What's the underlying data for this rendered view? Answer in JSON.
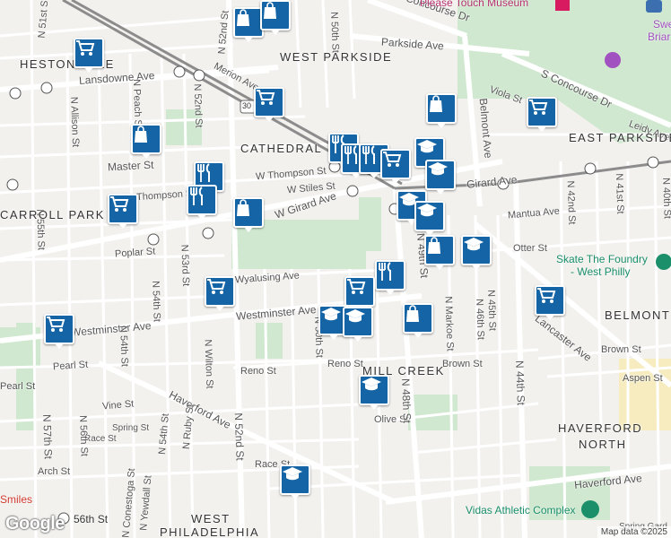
{
  "streets": [
    "Lansdowne Ave",
    "Merion Ave",
    "Master St",
    "W Thompson St",
    "Thompson St",
    "W Stiles St",
    "W Girard Ave",
    "Girard Ave",
    "Poplar St",
    "Wyalusing Ave",
    "Westminster Ave",
    "Westminster Ave",
    "Pearl St",
    "Reno St",
    "Reno St",
    "Brown St",
    "Brown St",
    "Haverford Ave",
    "Haverford Ave",
    "Vine St",
    "Spring St",
    "Race St",
    "Race St",
    "Arch St",
    "Olive St",
    "Aspen St",
    "Mantua Ave",
    "Otter St",
    "Viola St",
    "Leidy Ave",
    "Parkside Ave",
    "S Concourse Dr",
    "S Concourse Dr",
    "Belmont Ave",
    "Lancaster Ave",
    "N 52nd St",
    "N 52nd St",
    "N 53rd St",
    "N 54th St",
    "N 55th St",
    "N 56th St",
    "N 57th St",
    "N 50th St",
    "N 51st St",
    "N 49th St",
    "N 48th St",
    "N 46th St",
    "N Markoe St",
    "N 45th St",
    "N 44th St",
    "N 42nd St",
    "N 41st St",
    "N 40th St",
    "N Allison St",
    "N Peach St",
    "N Wilton St",
    "N Ruby St",
    "N Yewdall St",
    "N Conestoga St",
    "N 54th St",
    "N 50th St",
    "Spring Gard",
    "Pearl St",
    "N 52nd St",
    "N 54th St",
    "W"
  ],
  "neighborhoods": [
    "WEST PARKSIDE",
    "HESTONVILLE",
    "CATHEDRAL",
    "EAST PARKSIDE",
    "CARROLL PARK",
    "BELMONT",
    "MILL CREEK",
    "HAVERFORD",
    "NORTH",
    "WEST",
    "PHILADELPHIA"
  ],
  "pois": {
    "please_touch": "Please Touch Museum",
    "skate": "Skate The Foundry",
    "skate2": "- West Philly",
    "vidas": "Vidas Athletic Complex",
    "sweet_briar": "Swe",
    "sweet_briar2": "Briar V",
    "smiles": "Smiles",
    "station": "56th St"
  },
  "highways": [
    "30"
  ],
  "attribution": "Map data ©2025",
  "logo": "Google",
  "colors": {
    "pin": "#1565a6",
    "park": "#c8e6c9",
    "road": "#ffffff",
    "rail": "#8c8c8c",
    "water": "#a8d4f0"
  },
  "markers": [
    {
      "type": "shopping-bag"
    },
    {
      "type": "shopping-bag"
    },
    {
      "type": "shopping-cart"
    },
    {
      "type": "shopping-cart"
    },
    {
      "type": "shopping-bag"
    },
    {
      "type": "shopping-cart"
    },
    {
      "type": "restaurant"
    },
    {
      "type": "restaurant"
    },
    {
      "type": "restaurant"
    },
    {
      "type": "shopping-cart"
    },
    {
      "type": "school"
    },
    {
      "type": "school"
    },
    {
      "type": "shopping-bag"
    },
    {
      "type": "shopping-bag"
    },
    {
      "type": "restaurant"
    },
    {
      "type": "restaurant"
    },
    {
      "type": "shopping-cart"
    },
    {
      "type": "school"
    },
    {
      "type": "school"
    },
    {
      "type": "shopping-bag"
    },
    {
      "type": "school"
    },
    {
      "type": "restaurant"
    },
    {
      "type": "shopping-cart"
    },
    {
      "type": "school"
    },
    {
      "type": "school"
    },
    {
      "type": "shopping-cart"
    },
    {
      "type": "shopping-bag"
    },
    {
      "type": "school"
    },
    {
      "type": "shopping-cart"
    },
    {
      "type": "school"
    },
    {
      "type": "shopping-cart"
    }
  ]
}
